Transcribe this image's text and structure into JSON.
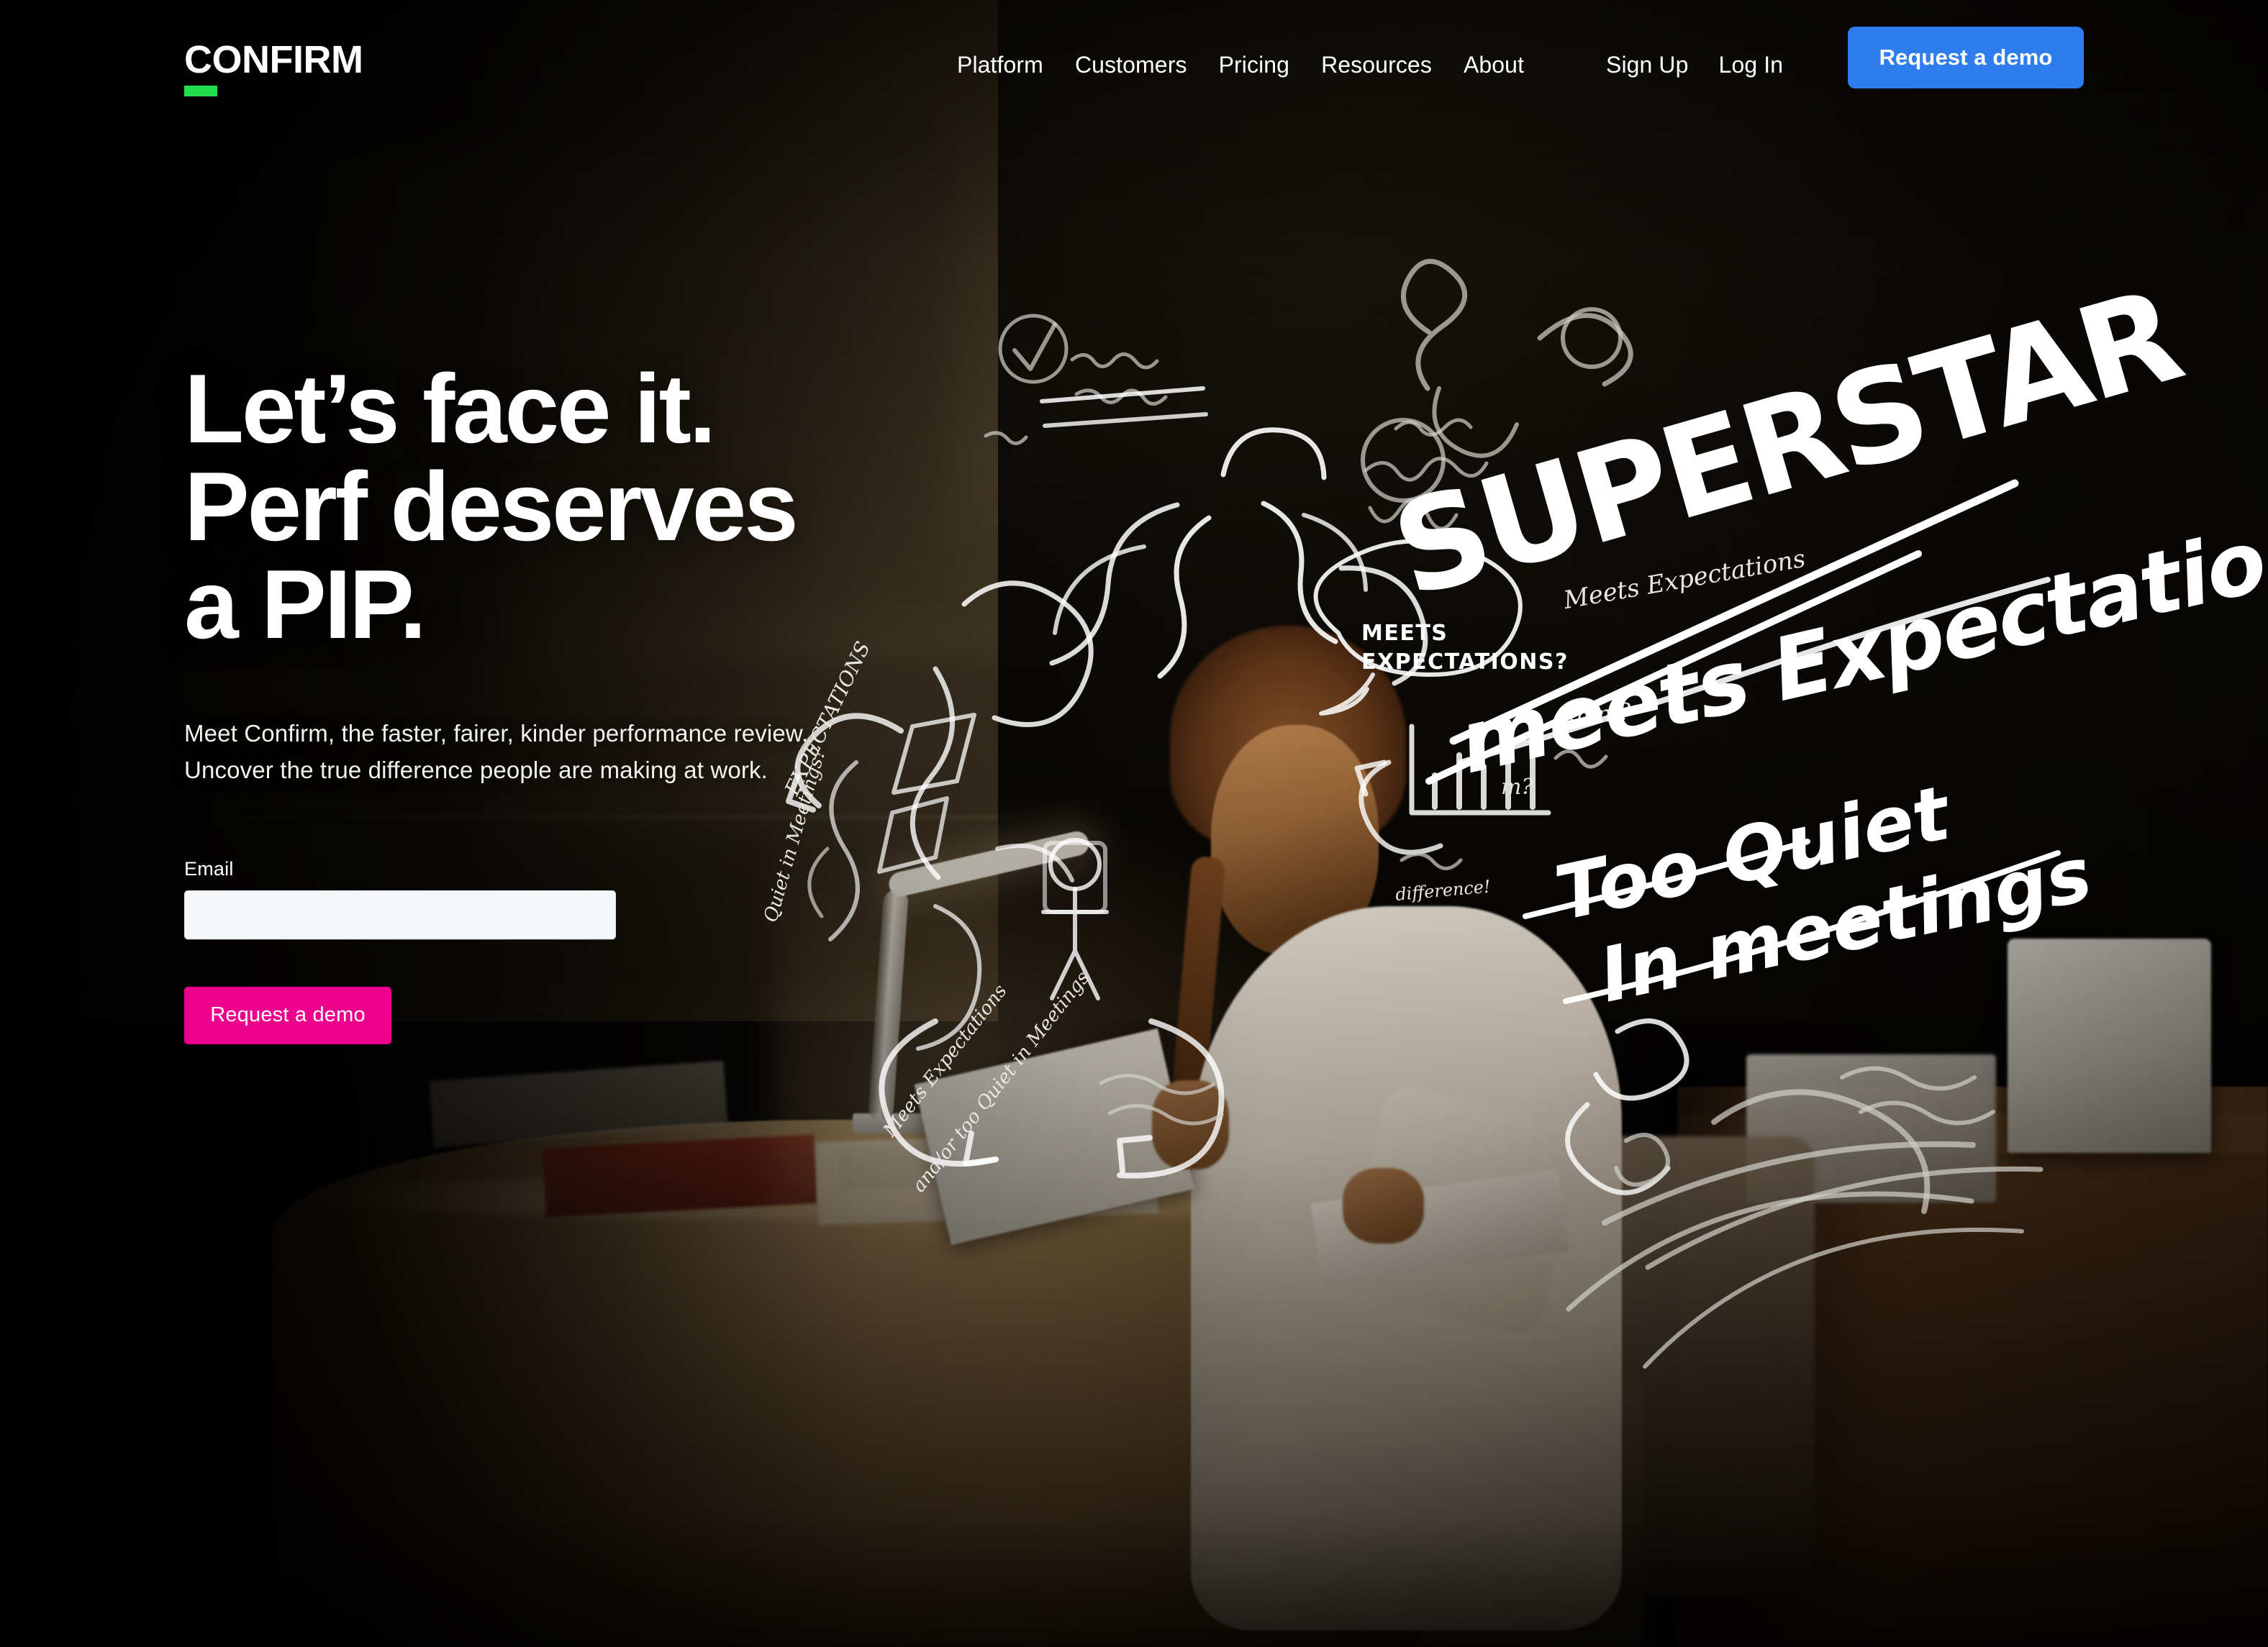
{
  "brand": {
    "logo_text": "CONFIRM",
    "accent_color": "#22DD4C"
  },
  "nav": {
    "links": [
      {
        "label": "Platform"
      },
      {
        "label": "Customers"
      },
      {
        "label": "Pricing"
      },
      {
        "label": "Resources"
      },
      {
        "label": "About"
      }
    ],
    "auth": [
      {
        "label": "Sign Up"
      },
      {
        "label": "Log In"
      }
    ],
    "cta": {
      "label": "Request a demo",
      "color": "#2F7CEE"
    }
  },
  "hero": {
    "headline_lines": [
      "Let’s face it.",
      "Perf deserves",
      "a PIP."
    ],
    "subhead_lines": [
      "Meet Confirm, the faster, fairer, kinder performance review.",
      "Uncover the true difference people are making at work."
    ],
    "form": {
      "email_label": "Email",
      "email_value": "",
      "email_placeholder": "",
      "submit_label": "Request a demo",
      "submit_color": "#EC008C"
    }
  },
  "background": {
    "scene_description": "Dimly lit office at night; a woman in a white outfit seated at a round wooden table reading papers beside a white desk lamp",
    "chalk_annotations": [
      {
        "text": "SUPERSTAR"
      },
      {
        "text": "meets Expectations"
      },
      {
        "text": "Too Quiet"
      },
      {
        "text": "In meetings"
      },
      {
        "text": "MEETS EXPECTATIONS?"
      },
      {
        "text": "Meets Expectations"
      },
      {
        "text": "Too Quiet"
      },
      {
        "text": "hmm?"
      }
    ]
  }
}
